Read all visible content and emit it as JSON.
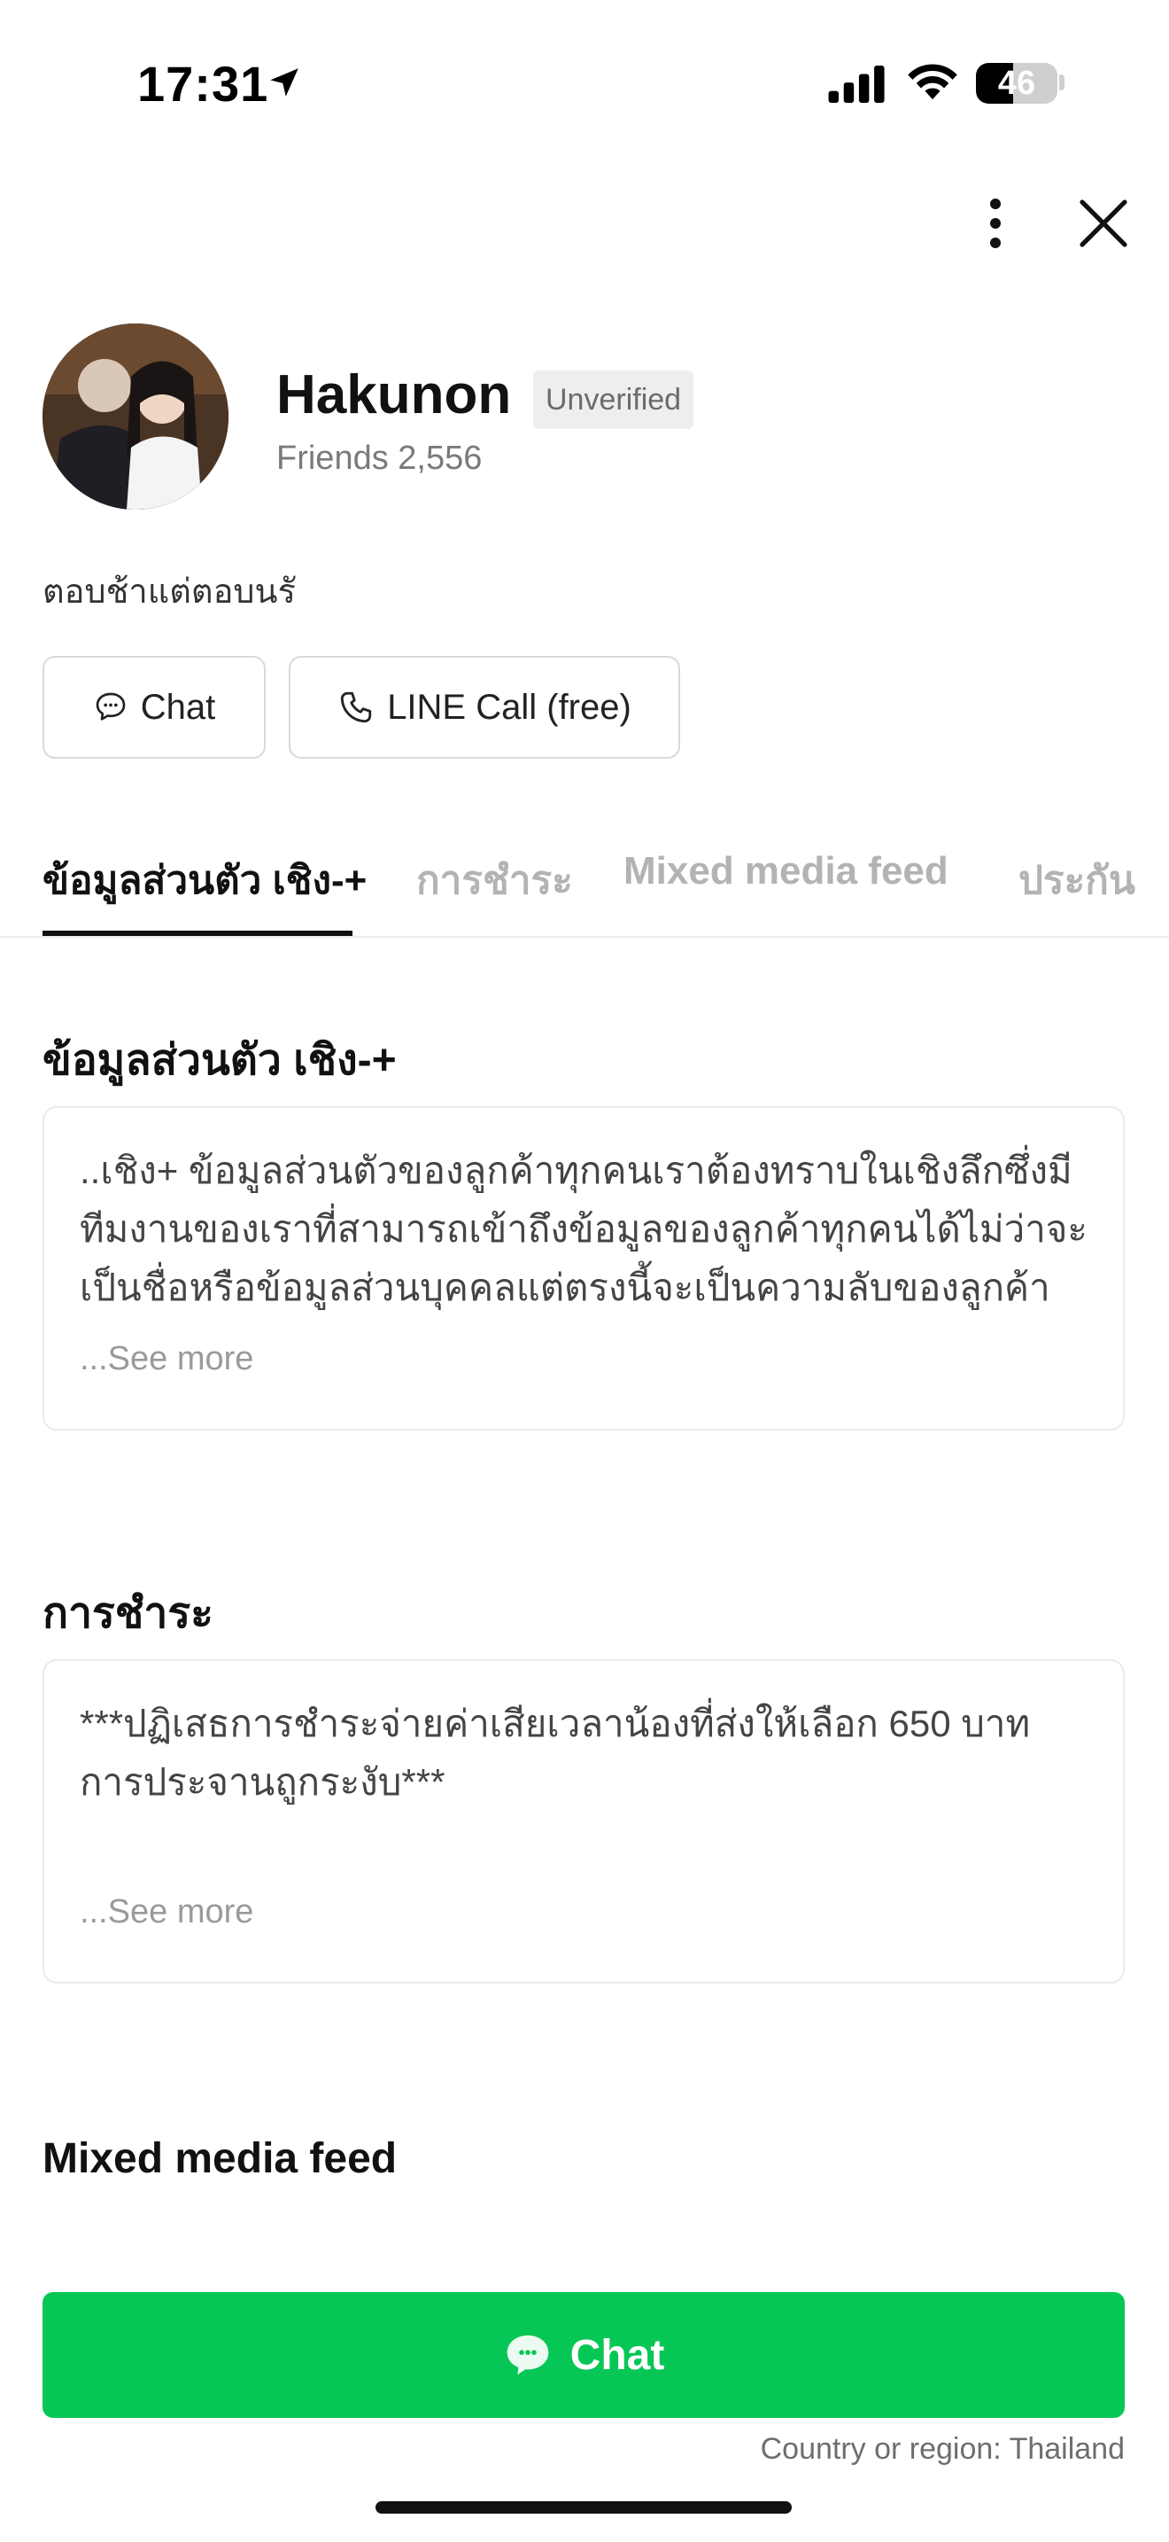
{
  "status_bar": {
    "time": "17:31",
    "battery": "46",
    "battery_level_percent": 46,
    "icons": [
      "location-arrow-icon",
      "cellular-signal-icon",
      "wifi-icon",
      "battery-icon"
    ]
  },
  "top_bar": {
    "icons": [
      "more-vertical-icon",
      "close-icon"
    ]
  },
  "profile": {
    "name": "Hakunon",
    "badge": "Unverified",
    "friends": "Friends 2,556",
    "status_message": "ตอบช้าแต่ตอบนรั"
  },
  "actions": {
    "chat_label": "Chat",
    "call_label": "LINE Call (free)"
  },
  "tabs": [
    {
      "label": "ข้อมูลส่วนตัว เชิง-+",
      "active": true
    },
    {
      "label": "การชำระ",
      "active": false
    },
    {
      "label": "Mixed media feed",
      "active": false
    },
    {
      "label": "ประกัน",
      "active": false
    }
  ],
  "sections": {
    "personal": {
      "title": "ข้อมูลส่วนตัว เชิง-+",
      "text": "..เชิง+ ข้อมูลส่วนตัวของลูกค้าทุกคนเราต้องทราบในเชิงลึกซึ่งมีทีมงานของเราที่สามารถเข้าถึงข้อมูลของลูกค้าทุกคนได้ไม่ว่าจะเป็นชื่อหรือข้อมูลส่วนบุคคลแต่ตรงนี้จะเป็นความลับของลูกค้าใน",
      "see_more": "...See more"
    },
    "payment": {
      "title": "การชำระ",
      "text": "***ปฏิเสธการชำระจ่ายค่าเสียเวลาน้องที่ส่งให้เลือก 650 บาท การประจานถูกระงับ***",
      "see_more": "...See more"
    },
    "media": {
      "title": "Mixed media feed"
    }
  },
  "bottom": {
    "chat_label": "Chat",
    "country": "Country or region: Thailand"
  },
  "colors": {
    "accent_green": "#06c755",
    "tab_inactive": "#b3b3b3"
  }
}
